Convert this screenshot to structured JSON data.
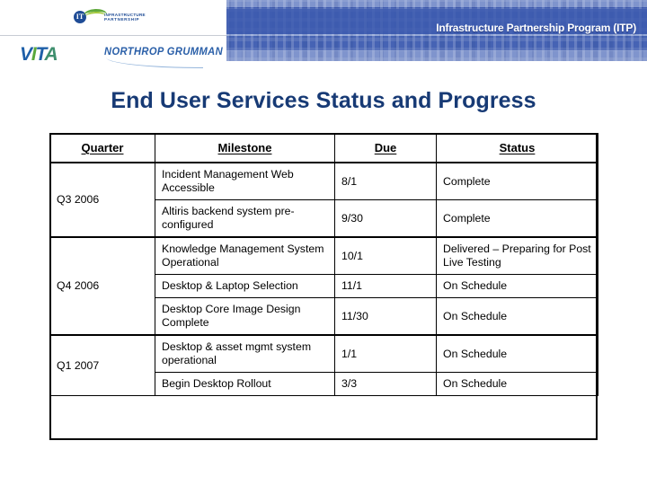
{
  "header": {
    "program_title": "Infrastructure Partnership Program (ITP)",
    "logos": {
      "infrastructure_partnership": {
        "mark_text": "IT",
        "line1": "INFRASTRUCTURE",
        "line2": "PARTNERSHIP"
      },
      "vita": {
        "l1": "V",
        "l2": "I",
        "l3": "T",
        "l4": "A"
      },
      "northrop_grumman": {
        "text": "NORTHROP GRUMMAN"
      }
    },
    "colors": {
      "band_light": "#7f94cd",
      "band_medium": "#4663b4",
      "band_dark": "#3f5cb0",
      "title_text": "#ffffff"
    }
  },
  "slide": {
    "title": "End User Services Status and Progress",
    "title_color": "#173a75"
  },
  "table": {
    "columns": [
      "Quarter",
      "Milestone",
      "Due",
      "Status"
    ],
    "groups": [
      {
        "quarter": "Q3 2006",
        "rows": [
          {
            "milestone": "Incident Management Web Accessible",
            "due": "8/1",
            "status": "Complete"
          },
          {
            "milestone": "Altiris backend system pre-configured",
            "due": "9/30",
            "status": "Complete"
          }
        ]
      },
      {
        "quarter": "Q4 2006",
        "rows": [
          {
            "milestone": "Knowledge Management System Operational",
            "due": "10/1",
            "status": "Delivered – Preparing for Post Live Testing"
          },
          {
            "milestone": "Desktop & Laptop Selection",
            "due": "11/1",
            "status": "On Schedule"
          },
          {
            "milestone": "Desktop Core Image Design Complete",
            "due": "11/30",
            "status": "On Schedule"
          }
        ]
      },
      {
        "quarter": "Q1 2007",
        "rows": [
          {
            "milestone": "Desktop & asset mgmt system operational",
            "due": "1/1",
            "status": "On Schedule"
          },
          {
            "milestone": "Begin Desktop Rollout",
            "due": "3/3",
            "status": "On Schedule"
          }
        ]
      }
    ]
  }
}
